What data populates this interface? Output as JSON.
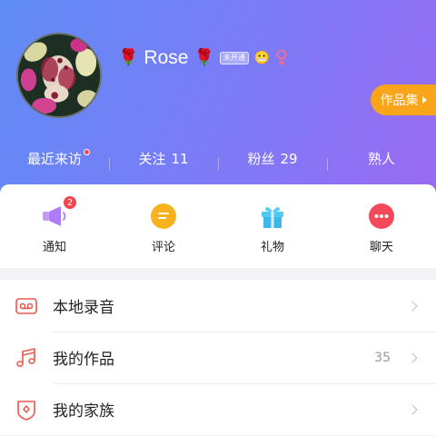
{
  "profile": {
    "username": "Rose",
    "rose_emoji": "🌹",
    "membership_badge": "未开通",
    "face_emoji": "😬",
    "works_button": "作品集"
  },
  "stats": [
    {
      "label": "最近来访",
      "value": ""
    },
    {
      "label": "关注",
      "value": "11"
    },
    {
      "label": "粉丝",
      "value": "29"
    },
    {
      "label": "熟人",
      "value": ""
    }
  ],
  "quick_actions": [
    {
      "label": "通知",
      "badge": "2"
    },
    {
      "label": "评论"
    },
    {
      "label": "礼物"
    },
    {
      "label": "聊天"
    }
  ],
  "menu": [
    {
      "label": "本地录音",
      "count": ""
    },
    {
      "label": "我的作品",
      "count": "35"
    },
    {
      "label": "我的家族",
      "count": ""
    }
  ],
  "colors": {
    "header_start": "#5f8cf5",
    "header_end": "#9a6af2",
    "works_button": "#f9a51b",
    "badge_red": "#f5434b",
    "menu_icon": "#e8584e"
  }
}
